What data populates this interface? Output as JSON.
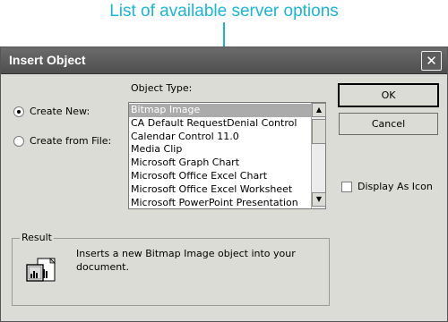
{
  "callout": {
    "text": "List of available server options"
  },
  "dialog": {
    "title": "Insert Object",
    "close_glyph": "✕"
  },
  "options": {
    "create_new": "Create New:",
    "create_from_file": "Create from File:",
    "selected": "create_new"
  },
  "object_type": {
    "label": "Object Type:",
    "items": [
      "Bitmap Image",
      "CA Default RequestDenial Control",
      "Calendar Control 11.0",
      "Media Clip",
      "Microsoft Graph Chart",
      "Microsoft Office Excel Chart",
      "Microsoft Office Excel Worksheet",
      "Microsoft PowerPoint Presentation"
    ],
    "selected_index": 0
  },
  "buttons": {
    "ok": "OK",
    "cancel": "Cancel"
  },
  "display_as_icon": {
    "label": "Display As Icon",
    "checked": false
  },
  "result": {
    "legend": "Result",
    "description_line1": "Inserts a new Bitmap Image object into your",
    "description_line2": "document."
  },
  "icons": {
    "close": "close-icon",
    "scroll_up": "scroll-up-arrow-icon",
    "scroll_down": "scroll-down-arrow-icon",
    "result": "insert-object-result-icon"
  },
  "colors": {
    "callout": "#19b6d6",
    "titlebar": "#5a5a5a",
    "dialog_bg": "#dcdcd6",
    "selection": "#ababab"
  }
}
